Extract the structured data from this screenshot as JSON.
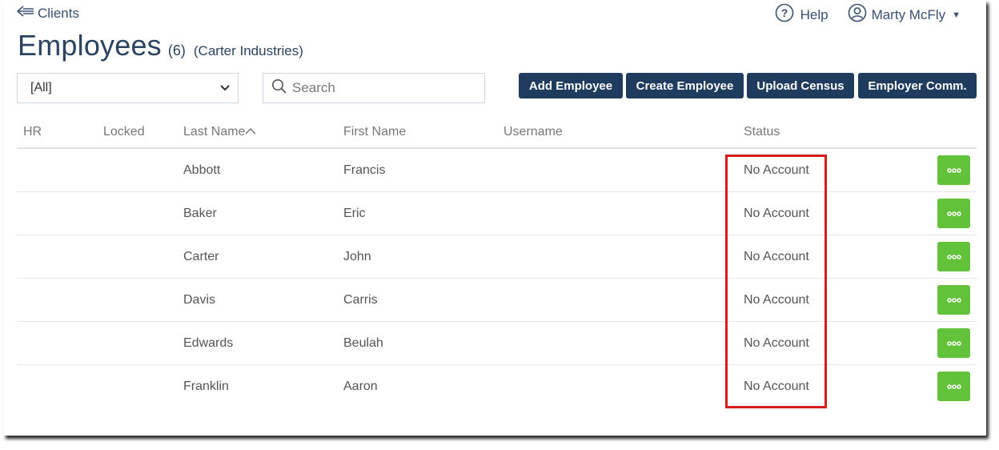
{
  "nav": {
    "back_label": "Clients",
    "help_label": "Help",
    "user_name": "Marty McFly"
  },
  "header": {
    "title": "Employees",
    "count": "(6)",
    "company": "(Carter Industries)"
  },
  "filters": {
    "select_value": "[All]",
    "search_placeholder": "Search"
  },
  "actions": {
    "add": "Add Employee",
    "create": "Create Employee",
    "upload": "Upload Census",
    "comm": "Employer Comm."
  },
  "table": {
    "columns": {
      "hr": "HR",
      "locked": "Locked",
      "last": "Last Name",
      "first": "First Name",
      "username": "Username",
      "status": "Status"
    },
    "rows": [
      {
        "hr": "",
        "locked": "",
        "last": "Abbott",
        "first": "Francis",
        "username": "",
        "status": "No Account"
      },
      {
        "hr": "",
        "locked": "",
        "last": "Baker",
        "first": "Eric",
        "username": "",
        "status": "No Account"
      },
      {
        "hr": "",
        "locked": "",
        "last": "Carter",
        "first": "John",
        "username": "",
        "status": "No Account"
      },
      {
        "hr": "",
        "locked": "",
        "last": "Davis",
        "first": "Carris",
        "username": "",
        "status": "No Account"
      },
      {
        "hr": "",
        "locked": "",
        "last": "Edwards",
        "first": "Beulah",
        "username": "",
        "status": "No Account"
      },
      {
        "hr": "",
        "locked": "",
        "last": "Franklin",
        "first": "Aaron",
        "username": "",
        "status": "No Account"
      }
    ]
  },
  "colors": {
    "primary_button": "#1f3b5e",
    "action_button": "#62c23a",
    "highlight": "#d61b1b",
    "heading": "#2b4360"
  }
}
